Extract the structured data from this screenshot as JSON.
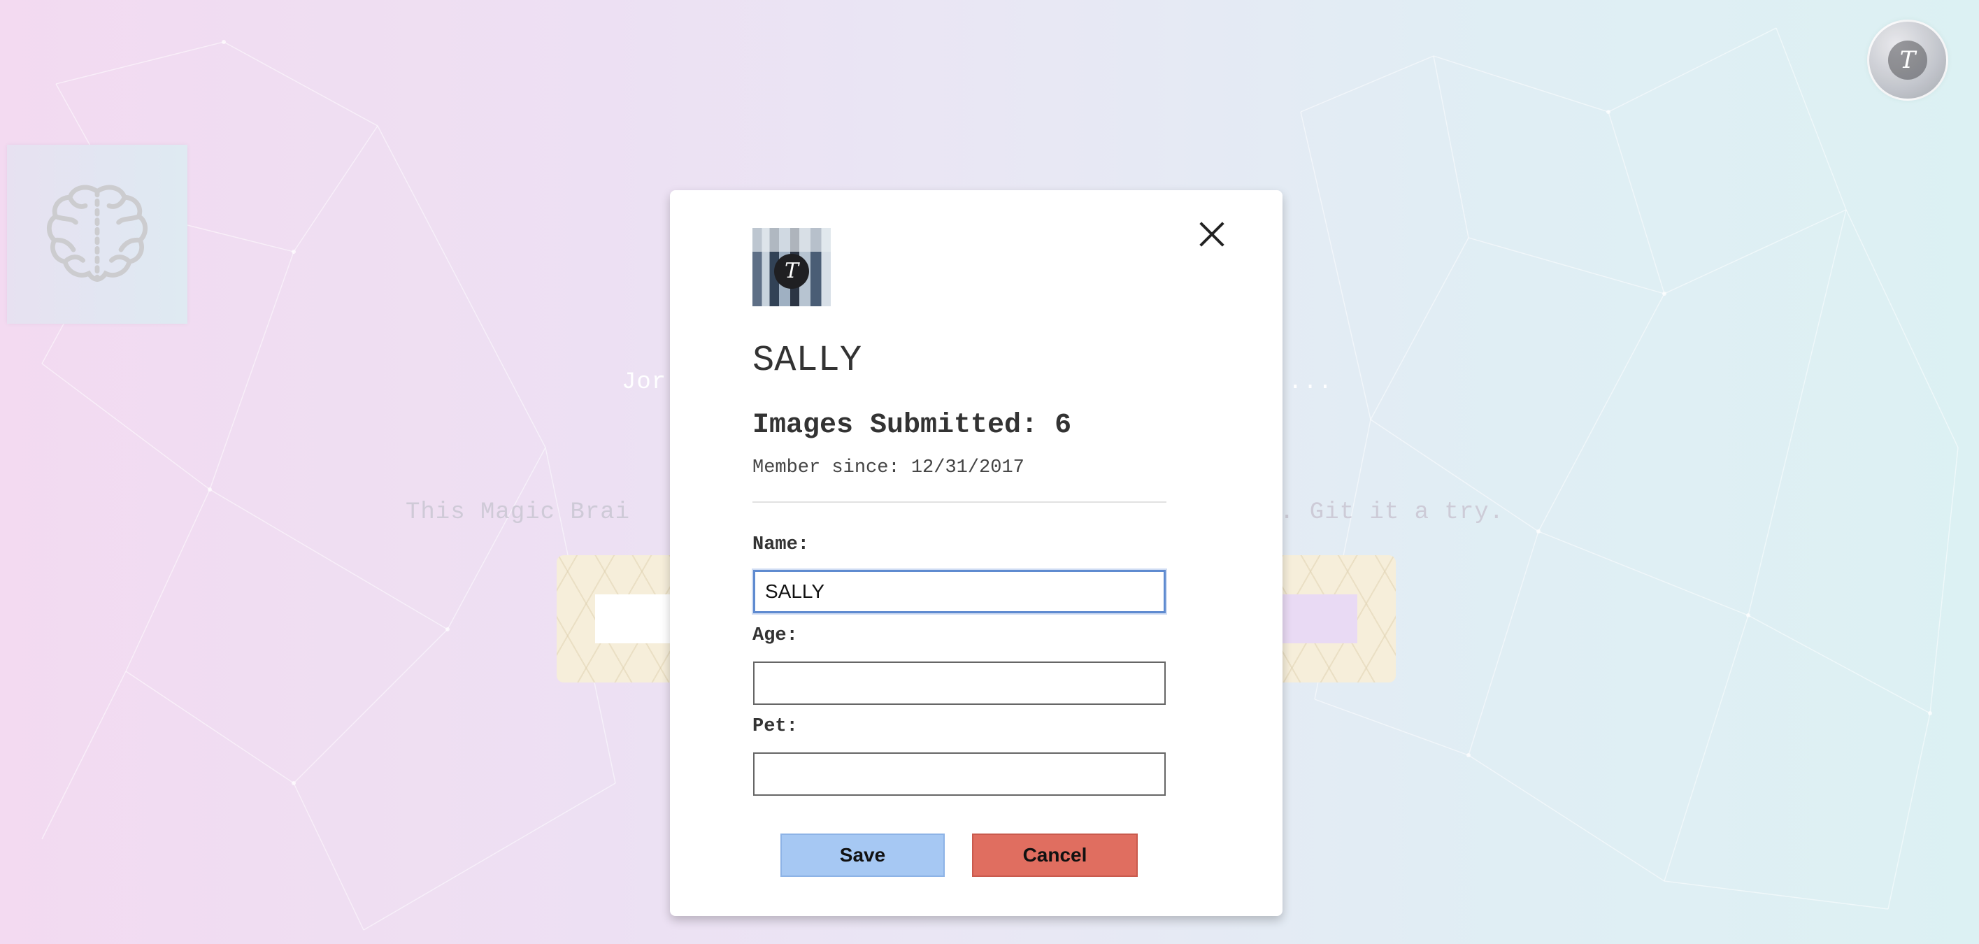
{
  "background": {
    "line1_left": "Jor",
    "line1_right": "...",
    "line2_left": "This Magic Brai",
    "line2_right": ". Git it a try."
  },
  "profile_icon": {
    "letter": "T"
  },
  "modal": {
    "avatar_letter": "T",
    "name": "SALLY",
    "images_submitted": "Images Submitted: 6",
    "member_since": "Member since: 12/31/2017",
    "fields": {
      "name": {
        "label": "Name:",
        "value": "SALLY"
      },
      "age": {
        "label": "Age:",
        "value": ""
      },
      "pet": {
        "label": "Pet:",
        "value": ""
      }
    },
    "save_label": "Save",
    "cancel_label": "Cancel"
  },
  "colors": {
    "save": "#a6c8f3",
    "cancel": "#e06e60",
    "focus": "#5f8bd0"
  }
}
